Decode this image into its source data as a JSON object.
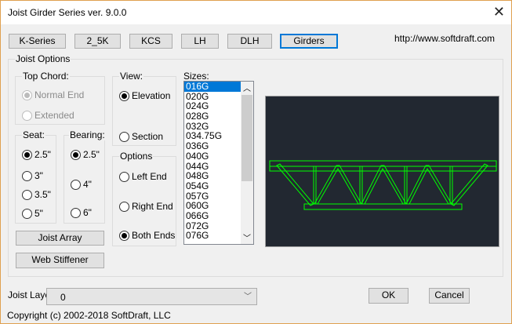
{
  "window": {
    "title": "Joist Girder Series ver. 9.0.0",
    "close": "✕"
  },
  "series_tabs": [
    {
      "label": "K-Series"
    },
    {
      "label": "2_5K"
    },
    {
      "label": "KCS"
    },
    {
      "label": "LH"
    },
    {
      "label": "DLH"
    },
    {
      "label": "Girders",
      "selected": true
    }
  ],
  "url": "http://www.softdraft.com",
  "joist_options": {
    "label": "Joist Options",
    "top_chord": {
      "label": "Top Chord:",
      "options": [
        "Normal End",
        "Extended"
      ],
      "selected": "Normal End",
      "disabled": true
    },
    "seat": {
      "label": "Seat:",
      "options": [
        "2.5\"",
        "3\"",
        "3.5\"",
        "5\""
      ],
      "selected": "2.5\""
    },
    "bearing": {
      "label": "Bearing:",
      "options": [
        "2.5\"",
        "4\"",
        "6\""
      ],
      "selected": "2.5\""
    },
    "view": {
      "label": "View:",
      "options": [
        "Elevation",
        "Section"
      ],
      "selected": "Elevation"
    },
    "options": {
      "label": "Options",
      "options": [
        "Left End",
        "Right End",
        "Both Ends"
      ],
      "selected": "Both Ends"
    },
    "joist_array": "Joist Array",
    "web_stiffener": "Web Stiffener",
    "sizes": {
      "label": "Sizes:",
      "items": [
        "016G",
        "020G",
        "024G",
        "028G",
        "032G",
        "034.75G",
        "036G",
        "040G",
        "044G",
        "048G",
        "054G",
        "057G",
        "060G",
        "066G",
        "072G",
        "076G"
      ],
      "selected": "016G"
    }
  },
  "preview": {
    "bg": "#222831",
    "line": "#00ff00"
  },
  "joist_layer": {
    "label": "Joist Layer:",
    "value": "0"
  },
  "ok": "OK",
  "cancel": "Cancel",
  "copyright": "Copyright (c) 2002-2018 SoftDraft, LLC"
}
